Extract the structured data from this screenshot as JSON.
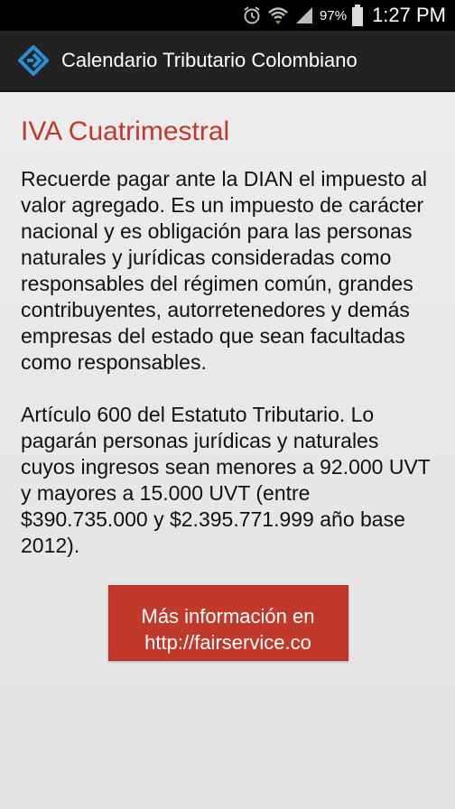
{
  "status_bar": {
    "battery_percent": "97%",
    "time": "1:27 PM",
    "icons": [
      "alarm-icon",
      "wifi-icon",
      "signal-icon",
      "battery-icon"
    ]
  },
  "action_bar": {
    "title": "Calendario Tributario Colombiano",
    "logo_icon": "app-logo-icon",
    "logo_color": "#2a8fd6"
  },
  "content": {
    "heading": "IVA Cuatrimestral",
    "heading_color": "#c0392b",
    "paragraphs": [
      "Recuerde pagar ante la DIAN el impuesto al valor agregado. Es un impuesto de carácter nacional y es obligación para las personas naturales y jurídicas consideradas como responsables del régimen común, grandes contribuyentes, autorretenedores y demás empresas del estado que sean facultadas como responsables.",
      "Artículo 600 del Estatuto Tributario. Lo pagarán personas jurídicas y naturales cuyos ingresos sean menores a 92.000 UVT y mayores a 15.000 UVT (entre $390.735.000 y $2.395.771.999 año base 2012)."
    ],
    "button": {
      "line1": "Más información en",
      "line2": "http://fairservice.co",
      "color": "#c0392b"
    }
  }
}
